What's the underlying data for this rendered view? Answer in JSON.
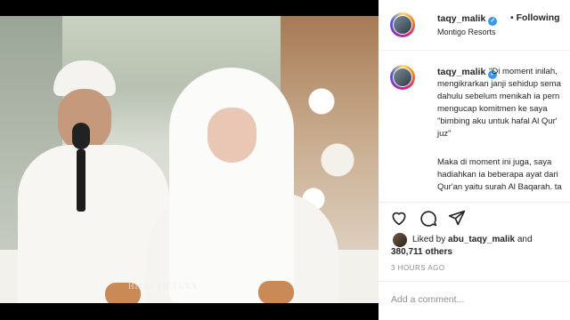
{
  "post": {
    "username": "taqy_malik",
    "following_label": "Following",
    "location": "Montigo Resorts",
    "photo_watermark": "HIJAS PICTURA",
    "caption_lines": [
      "\"Di moment inilah,",
      "mengikrarkan janji sehidup sema",
      "dahulu sebelum menikah ia pern",
      "mengucap komitmen ke saya",
      "\"bimbing aku untuk hafal Al Qur'",
      "juz\"",
      "",
      "Maka di moment ini juga, saya",
      "hadiahkan ia beberapa ayat dari",
      "Qur'an yaitu surah Al Baqarah. ta"
    ],
    "liked_by_prefix": "Liked by",
    "liked_by_user": "abu_taqy_malik",
    "liked_by_and": "and",
    "likes_count": "380,711 others",
    "timestamp": "3 HOURS AGO",
    "comment_placeholder": "Add a comment..."
  },
  "icons": [
    "heart-icon",
    "comment-icon",
    "share-icon",
    "verified-icon"
  ],
  "colors": {
    "verified": "#3897f0",
    "text": "#262626",
    "muted": "#8e8e8e"
  }
}
